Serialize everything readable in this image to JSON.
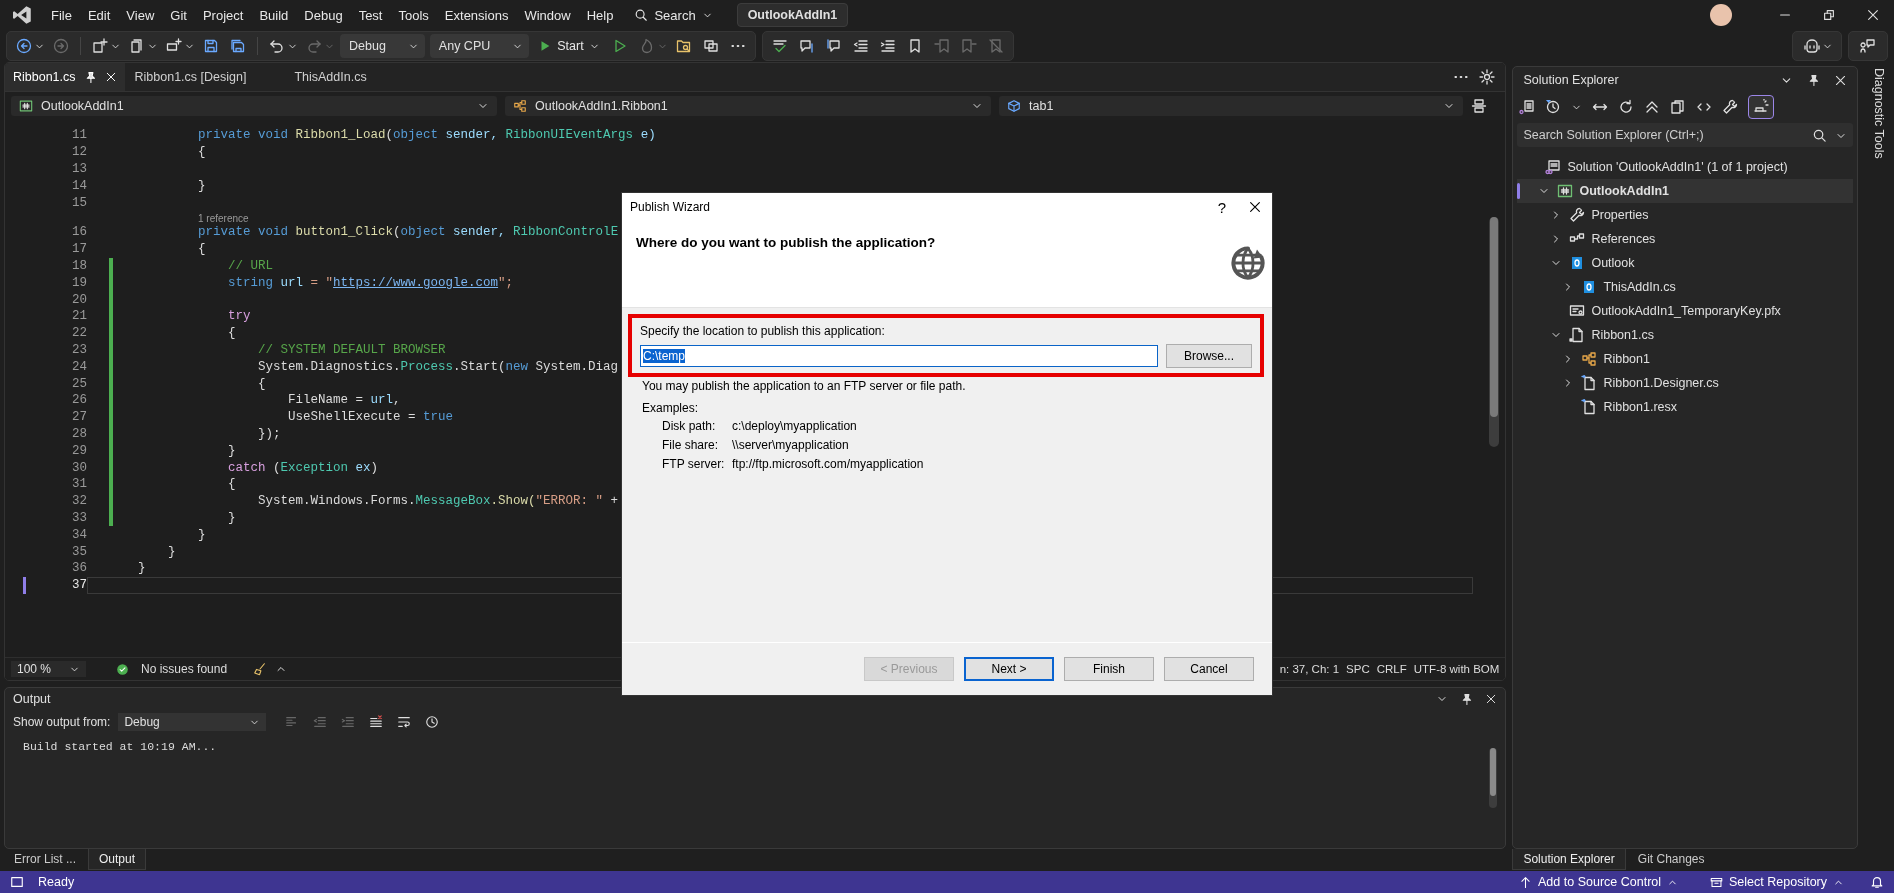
{
  "menu": [
    "File",
    "Edit",
    "View",
    "Git",
    "Project",
    "Build",
    "Debug",
    "Test",
    "Tools",
    "Extensions",
    "Window",
    "Help"
  ],
  "search": "Search",
  "solution_title": "OutlookAddIn1",
  "toolbar": {
    "left": [
      {
        "kind": "back",
        "disabled": false,
        "dropdown": true
      },
      {
        "kind": "forward",
        "disabled": true,
        "dropdown": false
      },
      {
        "kind": "new-project",
        "disabled": false,
        "dropdown": true
      },
      {
        "kind": "open-file",
        "disabled": false,
        "dropdown": true
      },
      {
        "kind": "add-item",
        "disabled": false,
        "dropdown": true
      },
      {
        "kind": "save",
        "disabled": false,
        "dropdown": false
      },
      {
        "kind": "save-all",
        "disabled": false,
        "dropdown": false
      },
      {
        "kind": "undo",
        "disabled": false,
        "dropdown": true
      },
      {
        "kind": "redo",
        "disabled": true,
        "dropdown": true
      }
    ],
    "configuration": "Debug",
    "platform": "Any CPU",
    "start": "Start",
    "run": [
      {
        "kind": "run",
        "disabled": false,
        "dropdown": false
      },
      {
        "kind": "hot-reload",
        "disabled": true,
        "dropdown": true
      },
      {
        "kind": "find-files",
        "disabled": false,
        "dropdown": false
      },
      {
        "kind": "windows",
        "disabled": false,
        "dropdown": false
      },
      {
        "kind": "more",
        "disabled": false,
        "dropdown": false
      }
    ],
    "edit": [
      {
        "kind": "spell",
        "disabled": false,
        "dropdown": false
      },
      {
        "kind": "comment",
        "disabled": false,
        "dropdown": false
      },
      {
        "kind": "uncomment",
        "disabled": false,
        "dropdown": false
      },
      {
        "kind": "outdent",
        "disabled": false,
        "dropdown": false
      },
      {
        "kind": "indent",
        "disabled": false,
        "dropdown": false
      },
      {
        "kind": "bookmark",
        "disabled": false,
        "dropdown": false
      },
      {
        "kind": "bookmark-prev",
        "disabled": true,
        "dropdown": false
      },
      {
        "kind": "bookmark-next",
        "disabled": true,
        "dropdown": false
      },
      {
        "kind": "bookmark-clear",
        "disabled": true,
        "dropdown": false
      }
    ]
  },
  "document_tabs": [
    {
      "label": "Ribbon1.cs",
      "selected": true,
      "pinned": true
    },
    {
      "label": "Ribbon1.cs [Design]",
      "selected": false,
      "pinned": false
    },
    {
      "label": "ThisAddIn.cs",
      "selected": false,
      "pinned": false
    }
  ],
  "navigation_bar": {
    "project": "OutlookAddIn1",
    "type": "OutlookAddIn1.Ribbon1",
    "member": "tab1"
  },
  "editor": {
    "lines": [
      {
        "number": "11",
        "current": false,
        "changed": false,
        "tokens": [
          {
            "text": "        private void ",
            "kind": "keyword"
          },
          {
            "text": "Ribbon1_Load",
            "kind": "method"
          },
          {
            "text": "(",
            "kind": "plain"
          },
          {
            "text": "object",
            "kind": "keyword"
          },
          {
            "text": " sender, ",
            "kind": "param"
          },
          {
            "text": "RibbonUIEventArgs",
            "kind": "type"
          },
          {
            "text": " e)",
            "kind": "param"
          }
        ]
      },
      {
        "number": "12",
        "current": false,
        "changed": false,
        "tokens": [
          {
            "text": "        {",
            "kind": "plain"
          }
        ]
      },
      {
        "number": "13",
        "current": false,
        "changed": false
      },
      {
        "number": "14",
        "current": false,
        "changed": false,
        "tokens": [
          {
            "text": "        }",
            "kind": "plain"
          }
        ]
      },
      {
        "number": "15",
        "current": false,
        "changed": false
      },
      {
        "number": "16",
        "current": false,
        "changed": false,
        "codelens": "1 reference",
        "tokens": [
          {
            "text": "        private void ",
            "kind": "keyword"
          },
          {
            "text": "button1_Click",
            "kind": "method"
          },
          {
            "text": "(",
            "kind": "plain"
          },
          {
            "text": "object",
            "kind": "keyword"
          },
          {
            "text": " sender, ",
            "kind": "param"
          },
          {
            "text": "RibbonControlE",
            "kind": "type"
          }
        ]
      },
      {
        "number": "17",
        "current": false,
        "changed": false,
        "tokens": [
          {
            "text": "        {",
            "kind": "plain"
          }
        ]
      },
      {
        "number": "18",
        "current": false,
        "changed": true,
        "tokens": [
          {
            "text": "            // URL",
            "kind": "comment"
          }
        ]
      },
      {
        "number": "19",
        "current": false,
        "changed": true,
        "tokens": [
          {
            "text": "            string ",
            "kind": "keyword"
          },
          {
            "text": "url",
            "kind": "param"
          },
          {
            "text": " = \"",
            "kind": "string"
          },
          {
            "text": "https://www.google.com",
            "kind": "link"
          },
          {
            "text": "\";",
            "kind": "string"
          }
        ]
      },
      {
        "number": "20",
        "current": false,
        "changed": true
      },
      {
        "number": "21",
        "current": false,
        "changed": true,
        "tokens": [
          {
            "text": "            try",
            "kind": "control"
          }
        ]
      },
      {
        "number": "22",
        "current": false,
        "changed": true,
        "tokens": [
          {
            "text": "            {",
            "kind": "plain"
          }
        ]
      },
      {
        "number": "23",
        "current": false,
        "changed": true,
        "tokens": [
          {
            "text": "                // SYSTEM DEFAULT BROWSER",
            "kind": "comment"
          }
        ]
      },
      {
        "number": "24",
        "current": false,
        "changed": true,
        "tokens": [
          {
            "text": "                System.Diagnostics.",
            "kind": "plain"
          },
          {
            "text": "Process",
            "kind": "type"
          },
          {
            "text": ".Start(",
            "kind": "plain"
          },
          {
            "text": "new ",
            "kind": "keyword"
          },
          {
            "text": "System.Diag",
            "kind": "plain"
          }
        ]
      },
      {
        "number": "25",
        "current": false,
        "changed": true,
        "tokens": [
          {
            "text": "                {",
            "kind": "plain"
          }
        ]
      },
      {
        "number": "26",
        "current": false,
        "changed": true,
        "tokens": [
          {
            "text": "                    FileName = ",
            "kind": "plain"
          },
          {
            "text": "url",
            "kind": "param"
          },
          {
            "text": ",",
            "kind": "plain"
          }
        ]
      },
      {
        "number": "27",
        "current": false,
        "changed": true,
        "tokens": [
          {
            "text": "                    UseShellExecute = ",
            "kind": "plain"
          },
          {
            "text": "true",
            "kind": "keyword"
          }
        ]
      },
      {
        "number": "28",
        "current": false,
        "changed": true,
        "tokens": [
          {
            "text": "                });",
            "kind": "plain"
          }
        ]
      },
      {
        "number": "29",
        "current": false,
        "changed": true,
        "tokens": [
          {
            "text": "            }",
            "kind": "plain"
          }
        ]
      },
      {
        "number": "30",
        "current": false,
        "changed": true,
        "tokens": [
          {
            "text": "            catch ",
            "kind": "control"
          },
          {
            "text": "(",
            "kind": "plain"
          },
          {
            "text": "Exception",
            "kind": "type"
          },
          {
            "text": " ex",
            "kind": "param"
          },
          {
            "text": ")",
            "kind": "plain"
          }
        ]
      },
      {
        "number": "31",
        "current": false,
        "changed": true,
        "tokens": [
          {
            "text": "            {",
            "kind": "plain"
          }
        ]
      },
      {
        "number": "32",
        "current": false,
        "changed": true,
        "tokens": [
          {
            "text": "                System.Windows.Forms.",
            "kind": "plain"
          },
          {
            "text": "MessageBox",
            "kind": "type"
          },
          {
            "text": ".Show(",
            "kind": "method"
          },
          {
            "text": "\"ERROR: \"",
            "kind": "string"
          },
          {
            "text": " +",
            "kind": "plain"
          }
        ]
      },
      {
        "number": "33",
        "current": false,
        "changed": true,
        "tokens": [
          {
            "text": "            }",
            "kind": "plain"
          }
        ]
      },
      {
        "number": "34",
        "current": false,
        "changed": false,
        "tokens": [
          {
            "text": "        }",
            "kind": "plain"
          }
        ]
      },
      {
        "number": "35",
        "current": false,
        "changed": false,
        "tokens": [
          {
            "text": "    }",
            "kind": "plain"
          }
        ]
      },
      {
        "number": "36",
        "current": false,
        "changed": false,
        "tokens": [
          {
            "text": "}",
            "kind": "plain"
          }
        ]
      },
      {
        "number": "37",
        "current": true,
        "changed": false
      }
    ],
    "zoom": "100 %",
    "issues": "No issues found",
    "position": "n: 37, Ch: 1",
    "whitespace": "SPC",
    "line_endings": "CRLF",
    "encoding": "UTF-8 with BOM"
  },
  "dialog": {
    "title": "Publish Wizard",
    "help": "?",
    "heading": "Where do you want to publish the application?",
    "location_label": "Specify the location to publish this application:",
    "location": "C:\\temp",
    "location_selected": true,
    "highlighted": true,
    "browse": "Browse...",
    "hint": "You may publish the application to an FTP server or file path.",
    "examples_label": "Examples:",
    "examples": [
      {
        "label": "Disk path:",
        "value": "c:\\deploy\\myapplication"
      },
      {
        "label": "File share:",
        "value": "\\\\server\\myapplication"
      },
      {
        "label": "FTP server:",
        "value": "ftp://ftp.microsoft.com/myapplication"
      }
    ],
    "buttons": [
      {
        "label": "< Previous",
        "disabled": true,
        "default": false
      },
      {
        "label": "Next >",
        "disabled": false,
        "default": true
      },
      {
        "label": "Finish",
        "disabled": false,
        "default": false
      },
      {
        "label": "Cancel",
        "disabled": false,
        "default": false
      }
    ]
  },
  "output": {
    "title": "Output",
    "source_label": "Show output from:",
    "source": "Debug",
    "text": "Build started at 10:19 AM...",
    "tools": [
      {
        "kind": "align-left",
        "disabled": true
      },
      {
        "kind": "outdent",
        "disabled": true
      },
      {
        "kind": "indent",
        "disabled": true
      },
      {
        "kind": "clear",
        "disabled": false
      },
      {
        "kind": "wrap",
        "disabled": false
      },
      {
        "kind": "clock",
        "disabled": false
      }
    ],
    "tabs": [
      {
        "label": "Error List ...",
        "selected": false
      },
      {
        "label": "Output",
        "selected": true
      }
    ]
  },
  "solution_explorer": {
    "title": "Solution Explorer",
    "search": {
      "placeholder": "Search Solution Explorer (Ctrl+;)"
    },
    "tools": [
      {
        "kind": "switch-views",
        "selected": false
      },
      {
        "kind": "history",
        "selected": false
      },
      {
        "kind": "sync",
        "selected": false
      },
      {
        "kind": "refresh",
        "selected": false
      },
      {
        "kind": "collapse",
        "selected": false
      },
      {
        "kind": "copy",
        "selected": false
      },
      {
        "kind": "code",
        "selected": false
      },
      {
        "kind": "wrench",
        "selected": false
      },
      {
        "kind": "preview",
        "selected": true
      }
    ],
    "tree": [
      {
        "label": "Solution 'OutlookAddIn1' (1 of 1 project)",
        "kind": "solution",
        "selected": false,
        "bold": false,
        "children": [
          {
            "label": "OutlookAddIn1",
            "kind": "project",
            "selected": true,
            "bold": true,
            "expanded": true,
            "children": [
              {
                "label": "Properties",
                "kind": "wrench",
                "selected": false,
                "bold": false,
                "expanded": false
              },
              {
                "label": "References",
                "kind": "references",
                "selected": false,
                "bold": false,
                "expanded": false
              },
              {
                "label": "Outlook",
                "kind": "outlook",
                "selected": false,
                "bold": false,
                "expanded": true,
                "children": [
                  {
                    "label": "ThisAddIn.cs",
                    "kind": "outlook",
                    "selected": false,
                    "bold": false,
                    "expanded": false
                  }
                ]
              },
              {
                "label": "OutlookAddIn1_TemporaryKey.pfx",
                "kind": "certificate",
                "selected": false,
                "bold": false
              },
              {
                "label": "Ribbon1.cs",
                "kind": "ribbon-file",
                "selected": false,
                "bold": false,
                "expanded": true,
                "children": [
                  {
                    "label": "Ribbon1",
                    "kind": "class",
                    "selected": false,
                    "bold": false,
                    "expanded": false
                  },
                  {
                    "label": "Ribbon1.Designer.cs",
                    "kind": "file",
                    "selected": false,
                    "bold": false,
                    "expanded": false
                  },
                  {
                    "label": "Ribbon1.resx",
                    "kind": "file",
                    "selected": false,
                    "bold": false
                  }
                ]
              }
            ]
          }
        ]
      }
    ],
    "tabs": [
      {
        "label": "Solution Explorer",
        "selected": true
      },
      {
        "label": "Git Changes",
        "selected": false
      }
    ]
  },
  "side_tab": "Diagnostic Tools",
  "status_bar": {
    "message": "Ready",
    "source_control": "Add to Source Control",
    "repository": "Select Repository"
  }
}
